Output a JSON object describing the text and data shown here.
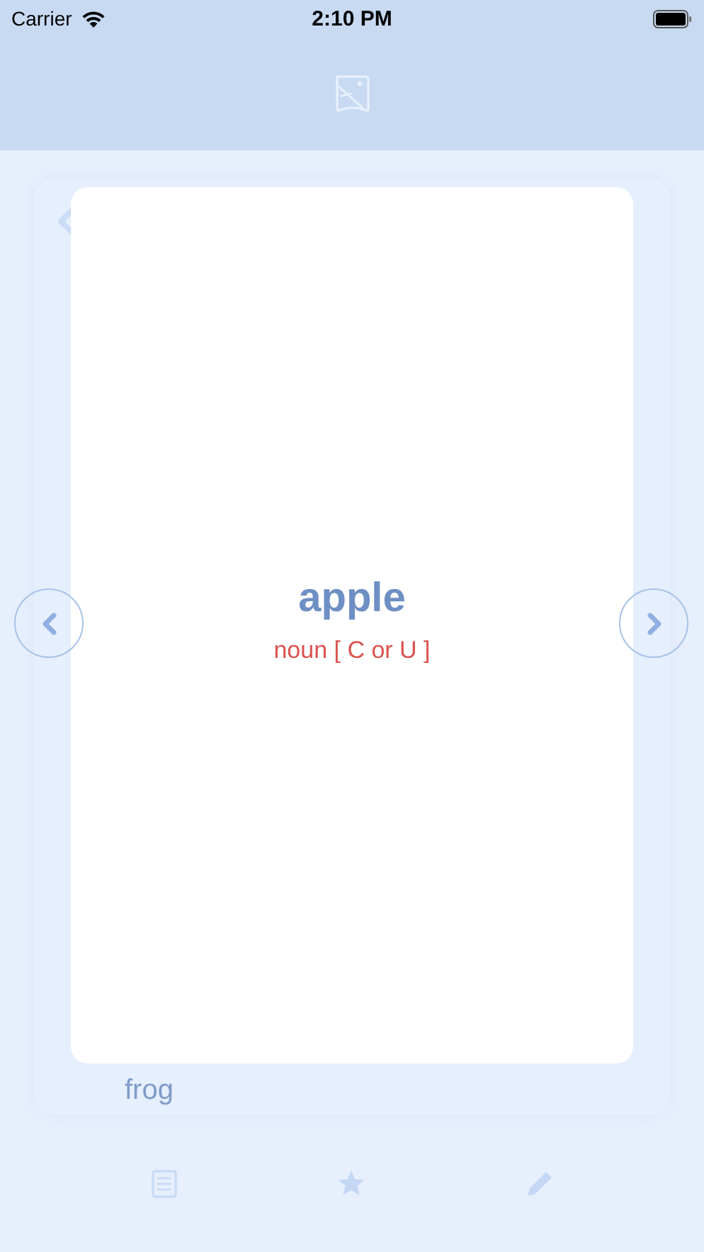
{
  "status_bar": {
    "carrier": "Carrier",
    "time": "2:10 PM"
  },
  "back_card": {
    "word": "frog"
  },
  "card": {
    "word": "apple",
    "part_of_speech": "noun [ C or U ]"
  }
}
